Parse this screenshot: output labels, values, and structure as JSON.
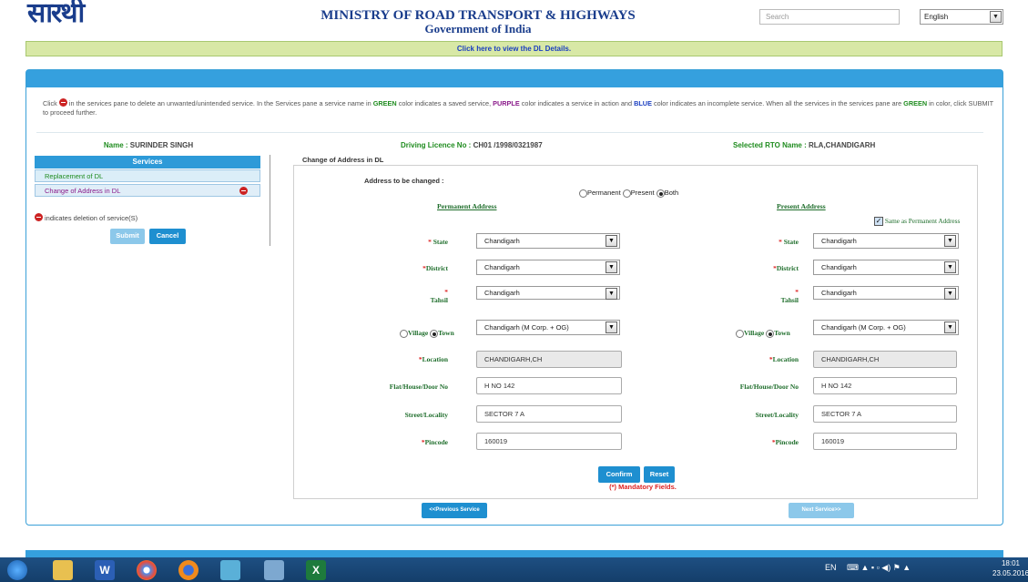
{
  "header": {
    "logo_text": "सारथी",
    "ministry": "MINISTRY OF ROAD TRANSPORT & HIGHWAYS",
    "government": "Government of India",
    "search_placeholder": "Search",
    "language": "English"
  },
  "dl_link": "Click here to view the DL Details.",
  "info": {
    "p1": "Click",
    "p2": " in the services pane to delete an unwanted/unintended service. In the Services pane a service name in ",
    "green": "GREEN",
    "p3": " color indicates a saved service, ",
    "purple": "PURPLE",
    "p4": " color indicates a service in action and ",
    "blue": "BLUE",
    "p5": " color indicates an incomplete service. When all the services in the services pane are ",
    "green2": "GREEN",
    "p6": " in color, click SUBMIT to proceed further."
  },
  "applicant": {
    "name_label": "Name : ",
    "name": "SURINDER SINGH",
    "dl_label": "Driving Licence No : ",
    "dl_no": "CH01 /1998/0321987",
    "rto_label": "Selected RTO Name : ",
    "rto": "RLA,CHANDIGARH"
  },
  "services": {
    "header": "Services",
    "items": [
      "Replacement of DL",
      "Change of Address in DL"
    ],
    "note": "indicates deletion of service(S)",
    "submit": "Submit",
    "cancel": "Cancel"
  },
  "form": {
    "title": "Change of Address in DL",
    "address_to_change_label": "Address to be changed :",
    "options": [
      "Permanent",
      "Present",
      "Both"
    ],
    "selected_option": "Both",
    "permanent_heading": "Permanent Address",
    "present_heading": "Present Address",
    "same_as_permanent": "Same as Permanent Address",
    "labels": {
      "state": "State",
      "district": "District",
      "tahsil": "Tahsil",
      "village": "Village",
      "town": "Town",
      "location": "Location",
      "flat": "Flat/House/Door No",
      "street": "Street/Locality",
      "pincode": "Pincode"
    },
    "permanent": {
      "state": "Chandigarh",
      "district": "Chandigarh",
      "tahsil": "Chandigarh",
      "town": "Chandigarh (M Corp. + OG)",
      "location": "CHANDIGARH,CH",
      "flat": "H NO 142",
      "street": "SECTOR 7 A",
      "pincode": "160019"
    },
    "present": {
      "state": "Chandigarh",
      "district": "Chandigarh",
      "tahsil": "Chandigarh",
      "town": "Chandigarh (M Corp. + OG)",
      "location": "CHANDIGARH,CH",
      "flat": "H NO 142",
      "street": "SECTOR 7 A",
      "pincode": "160019"
    },
    "confirm": "Confirm",
    "reset": "Reset",
    "mandatory_star": "(*)",
    "mandatory_text": " Mandatory Fields."
  },
  "nav": {
    "previous": "<<Previous Service",
    "next": "Next Service>>"
  },
  "taskbar": {
    "lang": "EN",
    "time": "18:01",
    "date": "23.05.2016"
  },
  "colors": {
    "accent": "#35a0de",
    "saved_green": "#1f8c1f",
    "in_action_purple": "#8a1a8a",
    "incomplete_blue": "#1a3ec0"
  }
}
